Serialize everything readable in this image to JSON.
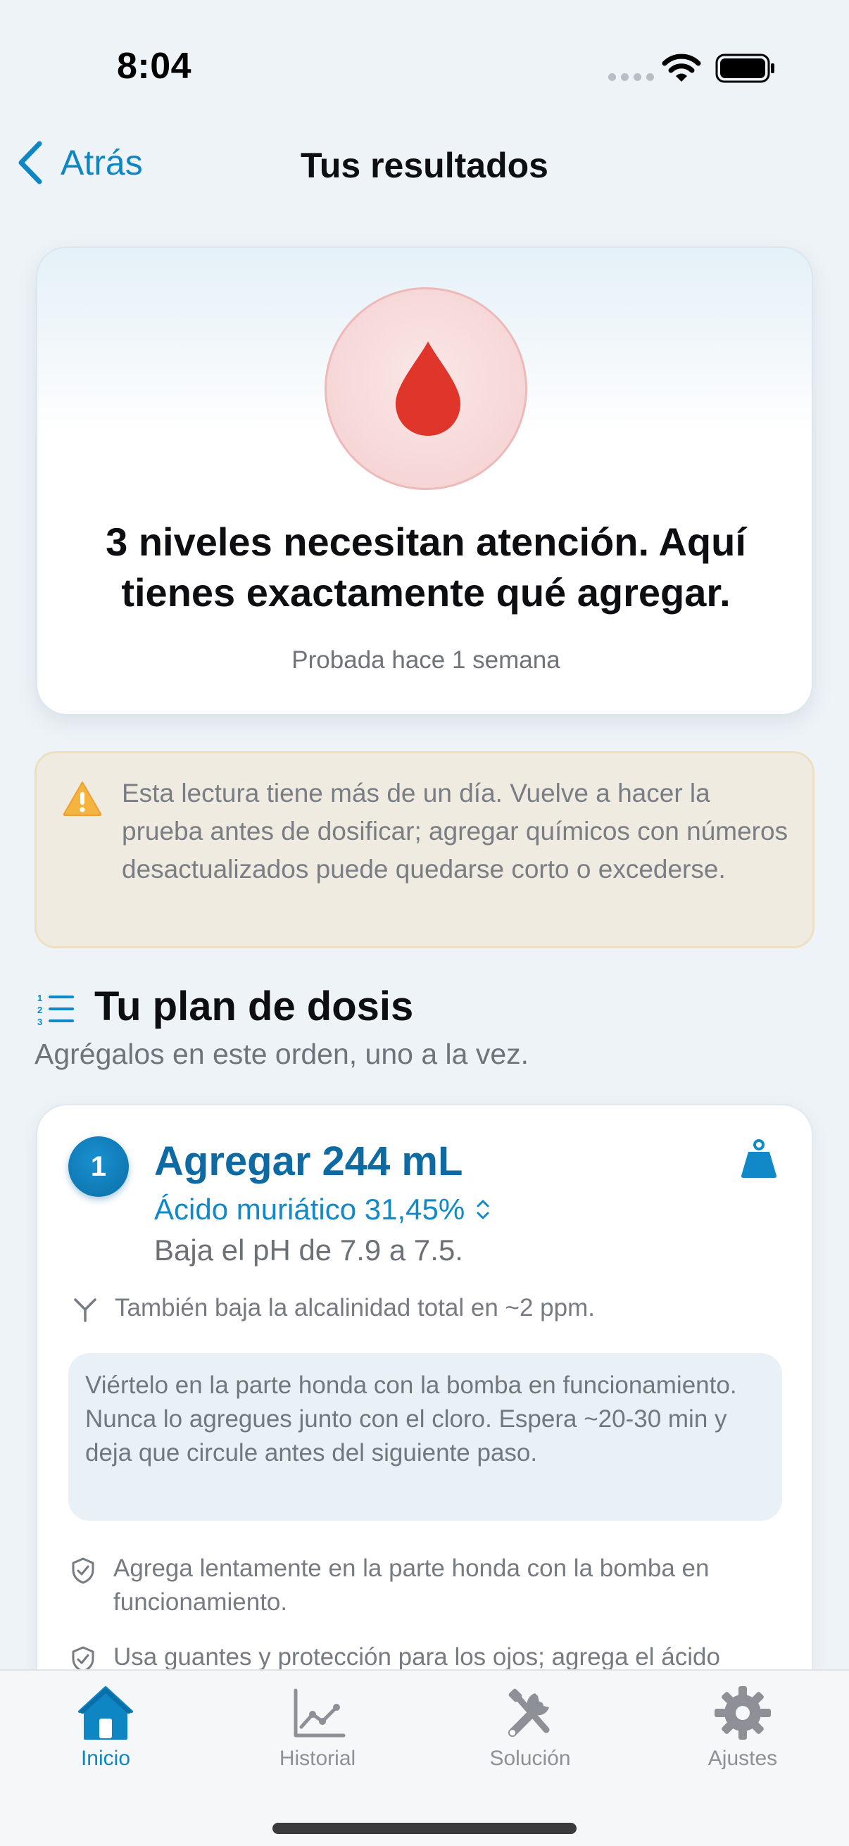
{
  "status_bar": {
    "time": "8:04",
    "icons": [
      "cellular-dots-icon",
      "wifi-icon",
      "battery-icon"
    ]
  },
  "nav": {
    "back_label": "Atrás",
    "title": "Tus resultados"
  },
  "hero": {
    "icon": "water-drop-icon",
    "title": "3 niveles necesitan atención. Aquí tienes exactamente qué agregar.",
    "subtitle": "Probada hace 1 semana"
  },
  "warning": {
    "icon": "warning-triangle-icon",
    "text": "Esta lectura tiene más de un día. Vuelve a hacer la prueba antes de dosificar; agregar químicos con números desactualizados puede quedarse corto o excederse."
  },
  "dose_plan": {
    "icon": "numbered-list-icon",
    "title": "Tu plan de dosis",
    "subtitle": "Agrégalos en este orden, uno a la vez.",
    "steps": [
      {
        "number": "1",
        "headline": "Agregar 244 mL",
        "product": "Ácido muriático 31,45%",
        "effect": "Baja el pH de 7.9 a 7.5.",
        "side_effect": "También baja la alcalinidad total en ~2 ppm.",
        "instruction": "Viértelo en la parte honda con la bomba en funcionamiento. Nunca lo agregues junto con el cloro. Espera ~20-30 min y deja que circule antes del siguiente paso.",
        "safety_notes": [
          "Agrega lentamente en la parte honda con la bomba en funcionamiento.",
          "Usa guantes y protección para los ojos; agrega el ácido"
        ]
      }
    ]
  },
  "tab_bar": {
    "tabs": [
      {
        "label": "Inicio",
        "icon": "house-icon",
        "active": true
      },
      {
        "label": "Historial",
        "icon": "chart-icon",
        "active": false
      },
      {
        "label": "Solución",
        "icon": "tools-icon",
        "active": false
      },
      {
        "label": "Ajustes",
        "icon": "gear-icon",
        "active": false
      }
    ]
  },
  "colors": {
    "accent": "#0e86c4",
    "danger": "#e0352b",
    "warning": "#f0a02a",
    "background": "#eef3f7"
  }
}
